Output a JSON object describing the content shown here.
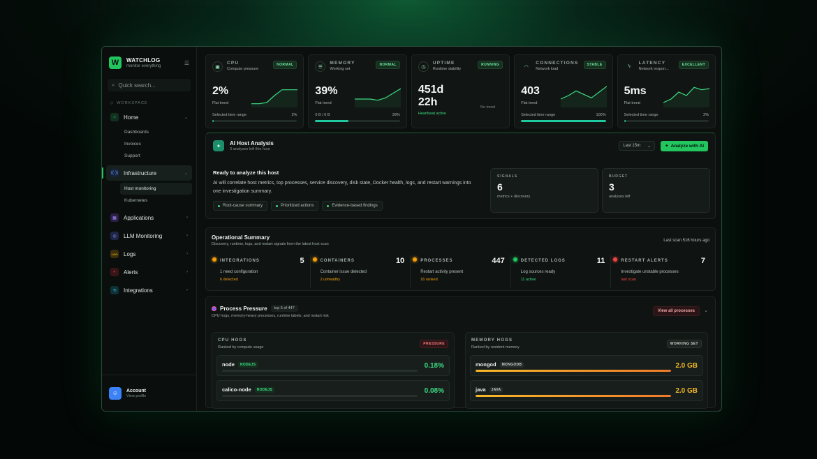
{
  "brand": {
    "name": "WATCHLOG",
    "tagline": "monitor everything",
    "logo_letter": "W"
  },
  "search": {
    "placeholder": "Quick search..."
  },
  "sidebar": {
    "section": "WORKSPACE",
    "items": [
      {
        "label": "Home",
        "icon": "home-icon",
        "color": "#22c55e",
        "expanded": true,
        "children": [
          "Dashboards",
          "Invoices",
          "Support"
        ]
      },
      {
        "label": "Infrastructure",
        "icon": "broadcast-icon",
        "color": "#4f8dff",
        "expanded": true,
        "active": true,
        "children": [
          "Host monitoring",
          "Kubernetes"
        ],
        "active_child": "Host monitoring"
      },
      {
        "label": "Applications",
        "icon": "apps-icon",
        "color": "#a78bfa"
      },
      {
        "label": "LLM Monitoring",
        "icon": "chat-icon",
        "color": "#8b9cff"
      },
      {
        "label": "Logs",
        "icon": "logs-icon",
        "color": "#eab308",
        "icon_text": "LOG"
      },
      {
        "label": "Alerts",
        "icon": "bell-icon",
        "color": "#ef4444"
      },
      {
        "label": "Integrations",
        "icon": "plug-icon",
        "color": "#22d3ee"
      }
    ]
  },
  "account": {
    "title": "Account",
    "subtitle": "View profile"
  },
  "metrics": [
    {
      "name": "CPU",
      "sub": "Compute pressure",
      "badge": "NORMAL",
      "value": "2%",
      "trend": "Flat trend",
      "range_label": "Selected time range",
      "range_value": "2%",
      "progress": 0.02,
      "icon": "cpu-icon",
      "spark": [
        2,
        2,
        3,
        9,
        14,
        14,
        14
      ]
    },
    {
      "name": "MEMORY",
      "sub": "Working set",
      "badge": "NORMAL",
      "value": "39%",
      "trend": "Flat trend",
      "range_label": "0 B / 0 B",
      "range_value": "39%",
      "progress": 0.39,
      "icon": "database-icon",
      "spark": [
        6,
        6,
        6,
        5,
        7,
        11,
        15
      ]
    },
    {
      "name": "UPTIME",
      "sub": "Runtime stability",
      "badge": "RUNNING",
      "value": "451d\n22h",
      "value_line1": "451d",
      "value_line2": "22h",
      "status": "Heartbeat active",
      "note": "No trend",
      "icon": "clock-icon"
    },
    {
      "name": "CONNECTIONS",
      "sub": "Network load",
      "badge": "STABLE",
      "value": "403",
      "trend": "Flat trend",
      "range_label": "Selected time range",
      "range_value": "100%",
      "progress": 1.0,
      "icon": "wifi-icon",
      "spark": [
        6,
        9,
        13,
        10,
        7,
        12,
        17
      ]
    },
    {
      "name": "LATENCY",
      "sub": "Network respon...",
      "badge": "EXCELLENT",
      "value": "5ms",
      "trend": "Flat trend",
      "range_label": "Selected time range",
      "range_value": "2%",
      "progress": 0.02,
      "icon": "bolt-icon",
      "spark": [
        3,
        6,
        12,
        9,
        16,
        14,
        15
      ]
    }
  ],
  "ai": {
    "title": "AI Host Analysis",
    "subtitle": "3 analyses left this hour",
    "select_value": "Last 15m",
    "button": "Analyze with AI",
    "ready_title": "Ready to analyze this host",
    "description": "AI will correlate host metrics, top processes, service discovery, disk state, Docker health, logs, and restart warnings into one investigation summary.",
    "chips": [
      "Root-cause summary",
      "Prioritized actions",
      "Evidence-based findings"
    ],
    "signals": {
      "label": "SIGNALS",
      "value": "6",
      "sub": "metrics + discovery"
    },
    "budget": {
      "label": "BUDGET",
      "value": "3",
      "sub": "analyses left"
    }
  },
  "ops": {
    "title": "Operational Summary",
    "subtitle": "Discovery, runtime, logs, and restart signals from the latest host scan",
    "last_scan": "Last scan 516 hours ago",
    "cells": [
      {
        "label": "INTEGRATIONS",
        "count": "5",
        "desc": "1 need configuration",
        "detail": "6 detected",
        "dot": "#f59e0b",
        "detail_color": "#f59e0b"
      },
      {
        "label": "CONTAINERS",
        "count": "10",
        "desc": "Container issue detected",
        "detail": "2 unhealthy",
        "dot": "#f59e0b",
        "detail_color": "#f59e0b"
      },
      {
        "label": "PROCESSES",
        "count": "447",
        "desc": "Restart activity present",
        "detail": "16 ranked",
        "dot": "#f59e0b",
        "detail_color": "#f59e0b"
      },
      {
        "label": "DETECTED LOGS",
        "count": "11",
        "desc": "Log sources ready",
        "detail": "11 active",
        "dot": "#22c55e",
        "detail_color": "#3ddc84"
      },
      {
        "label": "RESTART ALERTS",
        "count": "7",
        "desc": "Investigate unstable processes",
        "detail": "last scan",
        "dot": "#ef4444",
        "detail_color": "#ef4444"
      }
    ]
  },
  "pressure": {
    "title": "Process Pressure",
    "count": "top 5 of 447",
    "subtitle": "CPU hogs, memory-heavy processes, runtime labels, and restart risk",
    "button": "View all processes",
    "cpu": {
      "title": "CPU HOGS",
      "subtitle": "Ranked by compute usage",
      "badge": "PRESSURE",
      "rows": [
        {
          "name": "node",
          "tag": "NODEJS",
          "value": "0.18%",
          "fill": 0.0
        },
        {
          "name": "calico-node",
          "tag": "NODEJS",
          "value": "0.08%",
          "fill": 0.0
        }
      ]
    },
    "mem": {
      "title": "MEMORY HOGS",
      "subtitle": "Ranked by resident memory",
      "badge": "WORKING SET",
      "rows": [
        {
          "name": "mongod",
          "tag": "MONGODB",
          "value": "2.0 GB",
          "fill": 1.0
        },
        {
          "name": "java",
          "tag": "JAVA",
          "value": "2.0 GB",
          "fill": 1.0
        }
      ]
    }
  },
  "colors": {
    "accent": "#22c55e",
    "teal": "#20c8a0",
    "warn": "#f59e0b",
    "danger": "#ef4444",
    "gold": "#f5b92a"
  }
}
